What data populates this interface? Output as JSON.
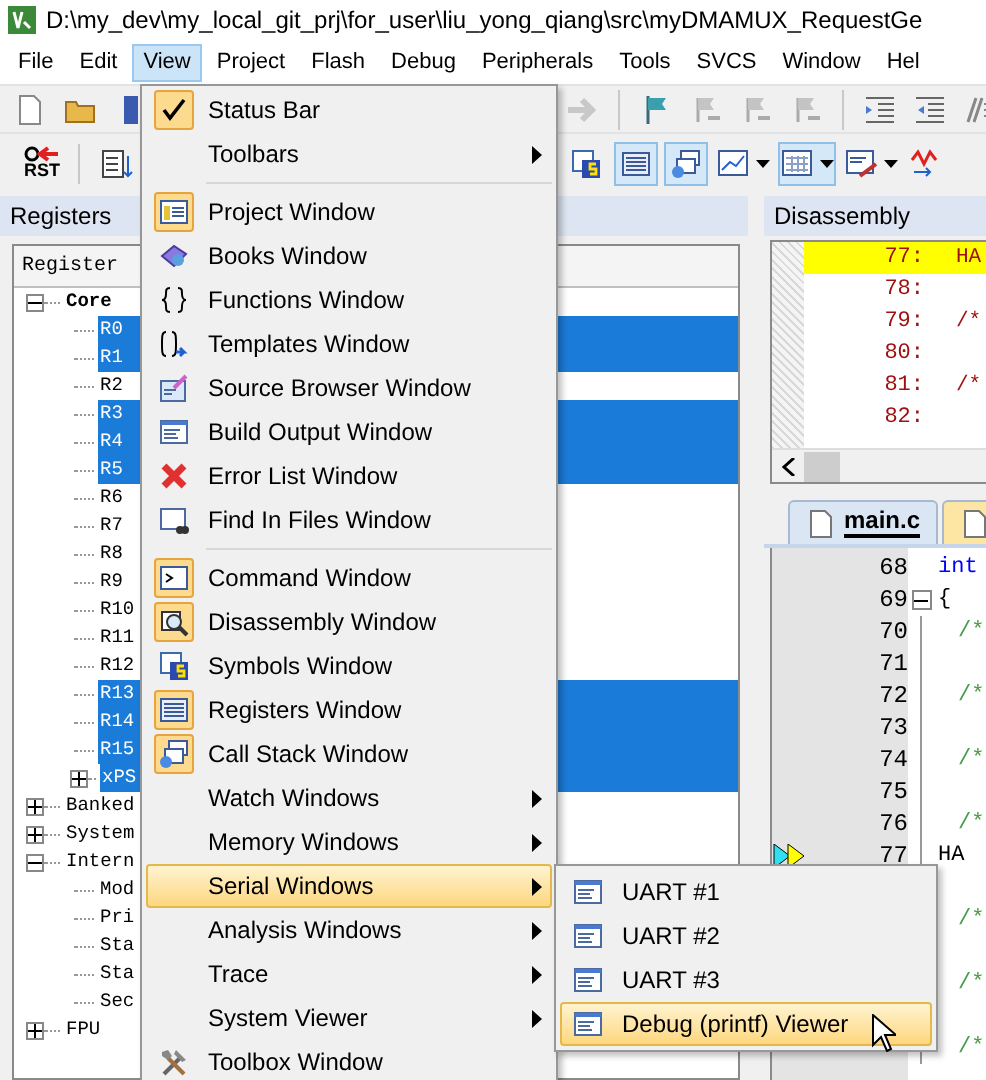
{
  "window": {
    "title": "D:\\my_dev\\my_local_git_prj\\for_user\\liu_yong_qiang\\src\\myDMAMUX_RequestGe"
  },
  "menu_bar": [
    {
      "label": "File",
      "selected": false
    },
    {
      "label": "Edit",
      "selected": false
    },
    {
      "label": "View",
      "selected": true
    },
    {
      "label": "Project",
      "selected": false
    },
    {
      "label": "Flash",
      "selected": false
    },
    {
      "label": "Debug",
      "selected": false
    },
    {
      "label": "Peripherals",
      "selected": false
    },
    {
      "label": "Tools",
      "selected": false
    },
    {
      "label": "SVCS",
      "selected": false
    },
    {
      "label": "Window",
      "selected": false
    },
    {
      "label": "Hel",
      "selected": false
    }
  ],
  "toolbar_1": {
    "left": [
      {
        "kind": "new",
        "pressed": false
      },
      {
        "kind": "open",
        "pressed": false
      },
      {
        "kind": "save",
        "pressed": false
      }
    ],
    "right": [
      {
        "kind": "forward",
        "pressed": false
      },
      {
        "kind": "separator"
      },
      {
        "kind": "flag",
        "pressed": false
      },
      {
        "kind": "bookmark",
        "pressed": false
      },
      {
        "kind": "bookmark",
        "pressed": false
      },
      {
        "kind": "bookmark",
        "pressed": false
      },
      {
        "kind": "separator"
      },
      {
        "kind": "indent",
        "pressed": false
      },
      {
        "kind": "unindent",
        "pressed": false
      },
      {
        "kind": "comment",
        "pressed": false
      }
    ]
  },
  "toolbar_2": {
    "left": [
      {
        "kind": "reset",
        "label": "RST",
        "pressed": false
      },
      {
        "kind": "separator"
      },
      {
        "kind": "listing",
        "pressed": false
      }
    ],
    "right": [
      {
        "kind": "symbols",
        "pressed": false
      },
      {
        "kind": "registers",
        "pressed": true
      },
      {
        "kind": "callstack",
        "pressed": true
      },
      {
        "kind": "watch",
        "pressed": false,
        "dropdown": true
      },
      {
        "kind": "memory",
        "pressed": true,
        "dropdown": true
      },
      {
        "kind": "serial",
        "pressed": false,
        "dropdown": true
      },
      {
        "kind": "trace",
        "pressed": false
      }
    ]
  },
  "registers": {
    "title": "Registers",
    "column": "Register",
    "tree": [
      {
        "label": "Core",
        "expanded": true,
        "selected": false,
        "children": [
          {
            "label": "R0",
            "selected": true
          },
          {
            "label": "R1",
            "selected": true
          },
          {
            "label": "R2",
            "selected": false
          },
          {
            "label": "R3",
            "selected": true
          },
          {
            "label": "R4",
            "selected": true
          },
          {
            "label": "R5",
            "selected": true
          },
          {
            "label": "R6",
            "selected": false
          },
          {
            "label": "R7",
            "selected": false
          },
          {
            "label": "R8",
            "selected": false
          },
          {
            "label": "R9",
            "selected": false
          },
          {
            "label": "R10",
            "selected": false
          },
          {
            "label": "R11",
            "selected": false
          },
          {
            "label": "R12",
            "selected": false
          },
          {
            "label": "R13",
            "selected": true
          },
          {
            "label": "R14",
            "selected": true
          },
          {
            "label": "R15",
            "selected": true
          },
          {
            "label": "xPS",
            "selected": true,
            "expanded": false
          }
        ]
      },
      {
        "label": "Banked",
        "selected": false,
        "expanded": false
      },
      {
        "label": "System",
        "selected": false,
        "expanded": false
      },
      {
        "label": "Intern",
        "selected": false,
        "expanded": true,
        "children": [
          {
            "label": "Mod",
            "selected": false
          },
          {
            "label": "Pri",
            "selected": false
          },
          {
            "label": "Sta",
            "selected": false
          },
          {
            "label": "Sta",
            "selected": false
          },
          {
            "label": "Sec",
            "selected": false
          }
        ]
      },
      {
        "label": "FPU",
        "selected": false,
        "expanded": false
      }
    ]
  },
  "disassembly": {
    "title": "Disassembly",
    "lines": [
      {
        "number": "77:",
        "code": "HA",
        "current": true
      },
      {
        "number": "78:",
        "current": false
      },
      {
        "number": "79:",
        "code": "/*",
        "current": false
      },
      {
        "number": "80:",
        "current": false
      },
      {
        "number": "81:",
        "code": "/*",
        "current": false
      },
      {
        "number": "82:",
        "current": false
      }
    ]
  },
  "editor": {
    "tabs": [
      {
        "label": "main.c",
        "selected": true
      },
      {
        "selected": false
      }
    ],
    "lines": [
      {
        "number": "68",
        "code": "int",
        "kind": "keyword",
        "current": false
      },
      {
        "number": "69",
        "code": "{",
        "kind": "plain",
        "fold": true,
        "current": false
      },
      {
        "number": "70",
        "code": "/*",
        "kind": "comment",
        "current": false
      },
      {
        "number": "71",
        "kind": "blank",
        "current": false
      },
      {
        "number": "72",
        "code": "/*",
        "kind": "comment",
        "current": false
      },
      {
        "number": "73",
        "kind": "blank",
        "current": false
      },
      {
        "number": "74",
        "code": "/*",
        "kind": "comment",
        "current": false
      },
      {
        "number": "75",
        "kind": "blank",
        "current": false
      },
      {
        "number": "76",
        "code": "/*",
        "kind": "comment",
        "current": false
      },
      {
        "number": "77",
        "code": "HA",
        "kind": "plain",
        "current": true
      },
      {
        "kind": "blank"
      },
      {
        "code": "/*",
        "kind": "comment"
      },
      {
        "kind": "blank"
      },
      {
        "code": "/*",
        "kind": "comment"
      },
      {
        "kind": "blank"
      },
      {
        "code": "/*",
        "kind": "comment"
      }
    ]
  },
  "view_menu": [
    {
      "kind": "check",
      "label": "Status Bar",
      "active": true,
      "selected": false
    },
    {
      "kind": "plain",
      "label": "Toolbars",
      "submenu": true,
      "active": false,
      "selected": false
    },
    {
      "kind": "separator"
    },
    {
      "kind": "project",
      "label": "Project Window",
      "active": true,
      "selected": false
    },
    {
      "kind": "books",
      "label": "Books Window",
      "active": false,
      "selected": false
    },
    {
      "kind": "braces",
      "label": "Functions Window",
      "active": false,
      "selected": false
    },
    {
      "kind": "templates",
      "label": "Templates Window",
      "active": false,
      "selected": false
    },
    {
      "kind": "source",
      "label": "Source Browser Window",
      "active": false,
      "selected": false
    },
    {
      "kind": "build",
      "label": "Build Output Window",
      "active": false,
      "selected": false
    },
    {
      "kind": "error",
      "label": "Error List Window",
      "active": false,
      "selected": false
    },
    {
      "kind": "find",
      "label": "Find In Files Window",
      "active": false,
      "selected": false
    },
    {
      "kind": "separator"
    },
    {
      "kind": "command",
      "label": "Command Window",
      "active": true,
      "selected": false
    },
    {
      "kind": "disasm",
      "label": "Disassembly Window",
      "active": true,
      "selected": false
    },
    {
      "kind": "symbols",
      "label": "Symbols Window",
      "active": false,
      "selected": false
    },
    {
      "kind": "registers",
      "label": "Registers Window",
      "active": true,
      "selected": false
    },
    {
      "kind": "callstack",
      "label": "Call Stack Window",
      "active": true,
      "selected": false
    },
    {
      "kind": "plain",
      "label": "Watch Windows",
      "submenu": true,
      "active": false,
      "selected": false
    },
    {
      "kind": "plain",
      "label": "Memory Windows",
      "submenu": true,
      "active": false,
      "selected": false
    },
    {
      "kind": "plain",
      "label": "Serial Windows",
      "submenu": true,
      "active": false,
      "selected": true
    },
    {
      "kind": "plain",
      "label": "Analysis Windows",
      "submenu": true,
      "active": false,
      "selected": false
    },
    {
      "kind": "plain",
      "label": "Trace",
      "submenu": true,
      "active": false,
      "selected": false
    },
    {
      "kind": "plain",
      "label": "System Viewer",
      "submenu": true,
      "active": false,
      "selected": false
    },
    {
      "kind": "toolbox",
      "label": "Toolbox Window",
      "active": false,
      "selected": false
    }
  ],
  "serial_menu": [
    {
      "label": "UART #1",
      "selected": false
    },
    {
      "label": "UART #2",
      "selected": false
    },
    {
      "label": "UART #3",
      "selected": false
    },
    {
      "label": "Debug (printf) Viewer",
      "selected": true
    }
  ]
}
